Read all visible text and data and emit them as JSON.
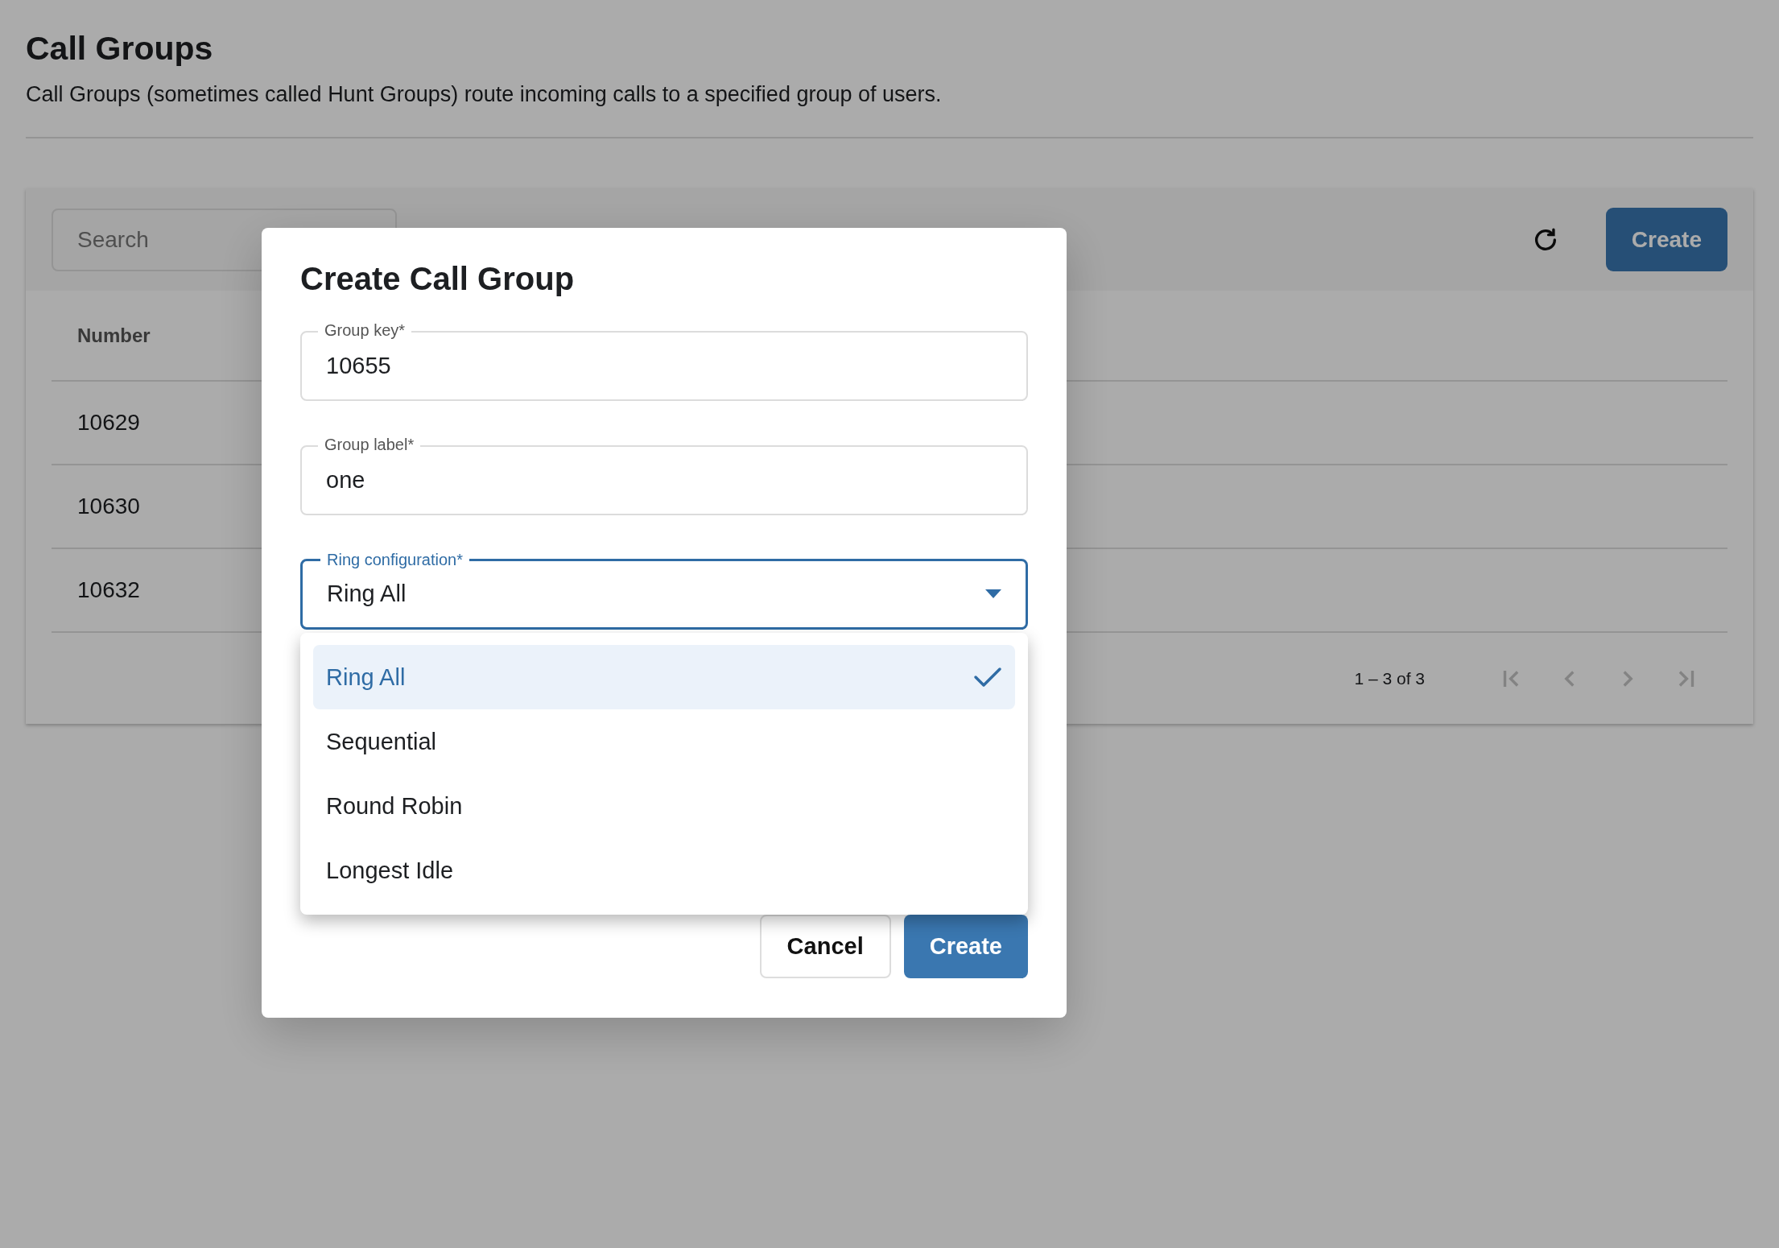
{
  "page": {
    "title": "Call Groups",
    "description": "Call Groups (sometimes called Hunt Groups) route incoming calls to a specified group of users."
  },
  "toolbar": {
    "search": {
      "placeholder": "Search"
    },
    "create_button": "Create"
  },
  "table": {
    "columns": [
      "Number"
    ],
    "rows": [
      {
        "number": "10629"
      },
      {
        "number": "10630"
      },
      {
        "number": "10632"
      }
    ]
  },
  "pagination": {
    "range": "1 – 3 of 3",
    "buttons": [
      {
        "kind": "first",
        "disabled": true
      },
      {
        "kind": "previous",
        "disabled": true
      },
      {
        "kind": "next",
        "disabled": true
      },
      {
        "kind": "last",
        "disabled": true
      }
    ]
  },
  "dialog": {
    "title": "Create Call Group",
    "fields": [
      {
        "kind": "text",
        "label": "Group key*",
        "value": "10655",
        "focused": false
      },
      {
        "kind": "text",
        "label": "Group label*",
        "value": "one",
        "focused": false
      },
      {
        "kind": "select",
        "label": "Ring configuration*",
        "value": "Ring All",
        "focused": true,
        "expanded": true,
        "options": [
          {
            "label": "Ring All",
            "selected": true
          },
          {
            "label": "Sequential",
            "selected": false
          },
          {
            "label": "Round Robin",
            "selected": false
          },
          {
            "label": "Longest Idle",
            "selected": false
          }
        ]
      }
    ],
    "buttons": [
      {
        "kind": "secondary",
        "label": "Cancel"
      },
      {
        "kind": "primary",
        "label": "Create"
      }
    ]
  }
}
